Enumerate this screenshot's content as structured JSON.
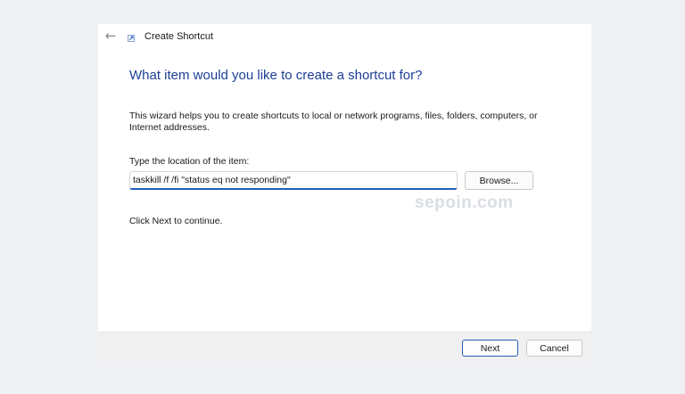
{
  "window": {
    "title": "Create Shortcut",
    "back_icon": "back-arrow-icon",
    "title_icon": "shortcut-icon"
  },
  "main": {
    "heading": "What item would you like to create a shortcut for?",
    "description": "This wizard helps you to create shortcuts to local or network programs, files, folders, computers, or Internet addresses.",
    "location_label": "Type the location of the item:",
    "location_value": "taskkill /f /fi \"status eq not responding\"",
    "browse_label": "Browse...",
    "continue_text": "Click Next to continue.",
    "watermark": "sepoin.com"
  },
  "footer": {
    "next_label": "Next",
    "cancel_label": "Cancel"
  },
  "colors": {
    "heading": "#1c3f95",
    "accent": "#1f5fb8",
    "background": "#eef0f3"
  }
}
